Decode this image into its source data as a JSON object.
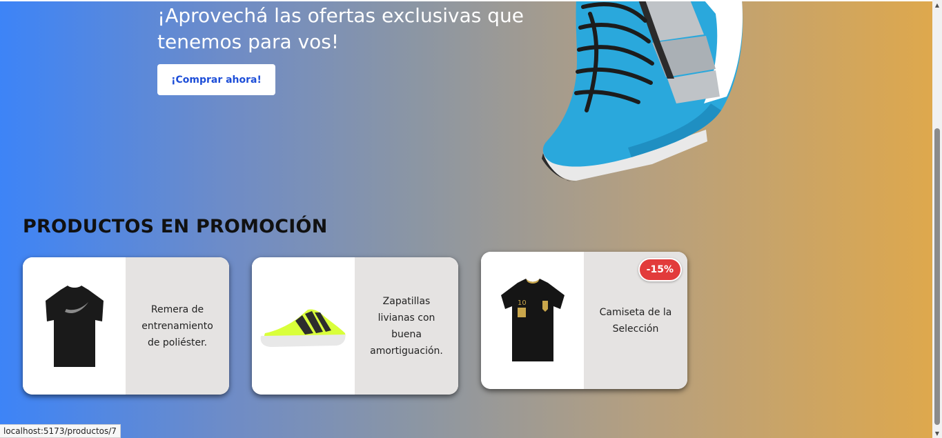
{
  "hero": {
    "title": "¡Aprovechá las ofertas exclusivas que tenemos para vos!",
    "button_label": "¡Comprar ahora!"
  },
  "promo": {
    "title": "PRODUCTOS EN PROMOCIÓN",
    "products": [
      {
        "description": "Remera de entrenamiento de poliéster.",
        "icon": "black-tshirt"
      },
      {
        "description": "Zapatillas livianas con buena amortiguación.",
        "icon": "neon-sneaker"
      },
      {
        "description": "Camiseta de la Selección",
        "icon": "black-jersey",
        "badge": "-15%"
      }
    ]
  },
  "status_bar": {
    "url": "localhost:5173/productos/7"
  },
  "colors": {
    "gradient_start": "#3d84f7",
    "gradient_end": "#dea84d",
    "badge": "#e23b3b",
    "button_text": "#1d4ed8"
  }
}
